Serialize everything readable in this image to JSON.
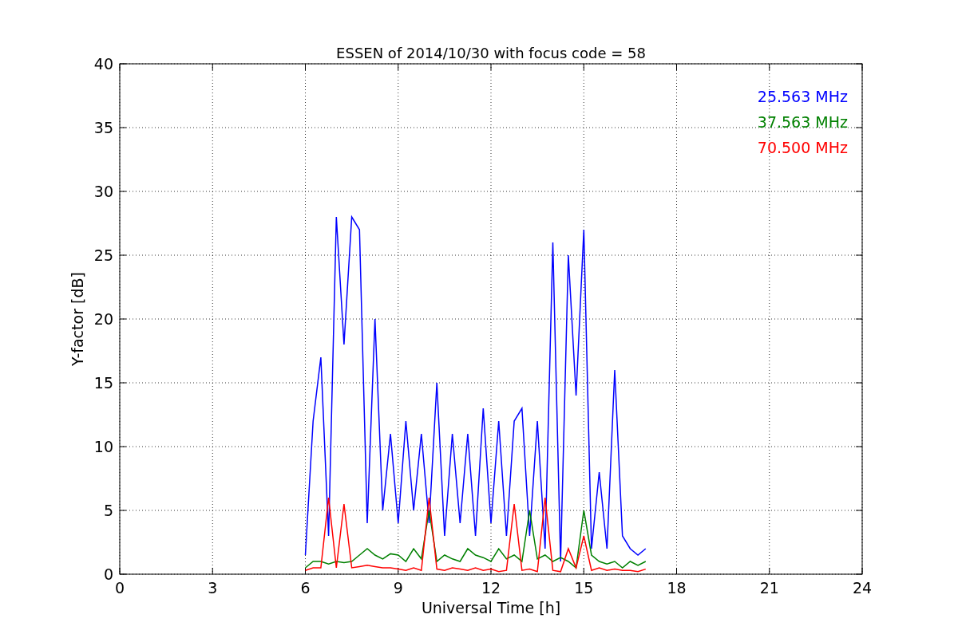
{
  "chart_data": {
    "type": "line",
    "title": "ESSEN of 2014/10/30 with focus code = 58",
    "xlabel": "Universal Time [h]",
    "ylabel": "Y-factor [dB]",
    "grid": true,
    "xlim": [
      0,
      24
    ],
    "ylim": [
      0,
      40
    ],
    "xticks": [
      0,
      3,
      6,
      9,
      12,
      15,
      18,
      21,
      24
    ],
    "yticks": [
      0,
      5,
      10,
      15,
      20,
      25,
      30,
      35,
      40
    ],
    "x": [
      6,
      6.25,
      6.5,
      6.75,
      7,
      7.25,
      7.5,
      7.75,
      8,
      8.25,
      8.5,
      8.75,
      9,
      9.25,
      9.5,
      9.75,
      10,
      10.25,
      10.5,
      10.75,
      11,
      11.25,
      11.5,
      11.75,
      12,
      12.25,
      12.5,
      12.75,
      13,
      13.25,
      13.5,
      13.75,
      14,
      14.25,
      14.5,
      14.75,
      15,
      15.25,
      15.5,
      15.75,
      16,
      16.25,
      16.5,
      16.75,
      17
    ],
    "series": [
      {
        "name": "25.563 MHz",
        "color": "#0000ff",
        "values": [
          1.5,
          12,
          17,
          3,
          28,
          18,
          28,
          27,
          4,
          20,
          5,
          11,
          4,
          12,
          5,
          11,
          4,
          15,
          3,
          11,
          4,
          11,
          3,
          13,
          4,
          12,
          3,
          12,
          13,
          3,
          12,
          2,
          26,
          1,
          25,
          14,
          27,
          2,
          8,
          2,
          16,
          3,
          2,
          1.5,
          2
        ]
      },
      {
        "name": "37.563 MHz",
        "color": "#008000",
        "values": [
          0.5,
          1,
          1,
          0.8,
          1,
          0.9,
          1,
          1.5,
          2,
          1.5,
          1.2,
          1.6,
          1.5,
          1,
          2,
          1.2,
          5,
          1,
          1.5,
          1.2,
          1,
          2,
          1.5,
          1.3,
          1,
          2,
          1.2,
          1.5,
          1,
          5,
          1.2,
          1.5,
          1,
          1.3,
          1,
          0.5,
          5,
          1.5,
          1,
          0.8,
          1,
          0.5,
          1,
          0.7,
          1
        ]
      },
      {
        "name": "70.500 MHz",
        "color": "#ff0000",
        "values": [
          0.3,
          0.5,
          0.5,
          6,
          0.5,
          5.5,
          0.5,
          0.6,
          0.7,
          0.6,
          0.5,
          0.5,
          0.4,
          0.3,
          0.5,
          0.3,
          6,
          0.4,
          0.3,
          0.5,
          0.4,
          0.3,
          0.5,
          0.3,
          0.4,
          0.2,
          0.3,
          5.5,
          0.3,
          0.4,
          0.2,
          6,
          0.3,
          0.2,
          2,
          0.5,
          3,
          0.3,
          0.5,
          0.3,
          0.4,
          0.3,
          0.3,
          0.2,
          0.4
        ]
      }
    ]
  }
}
